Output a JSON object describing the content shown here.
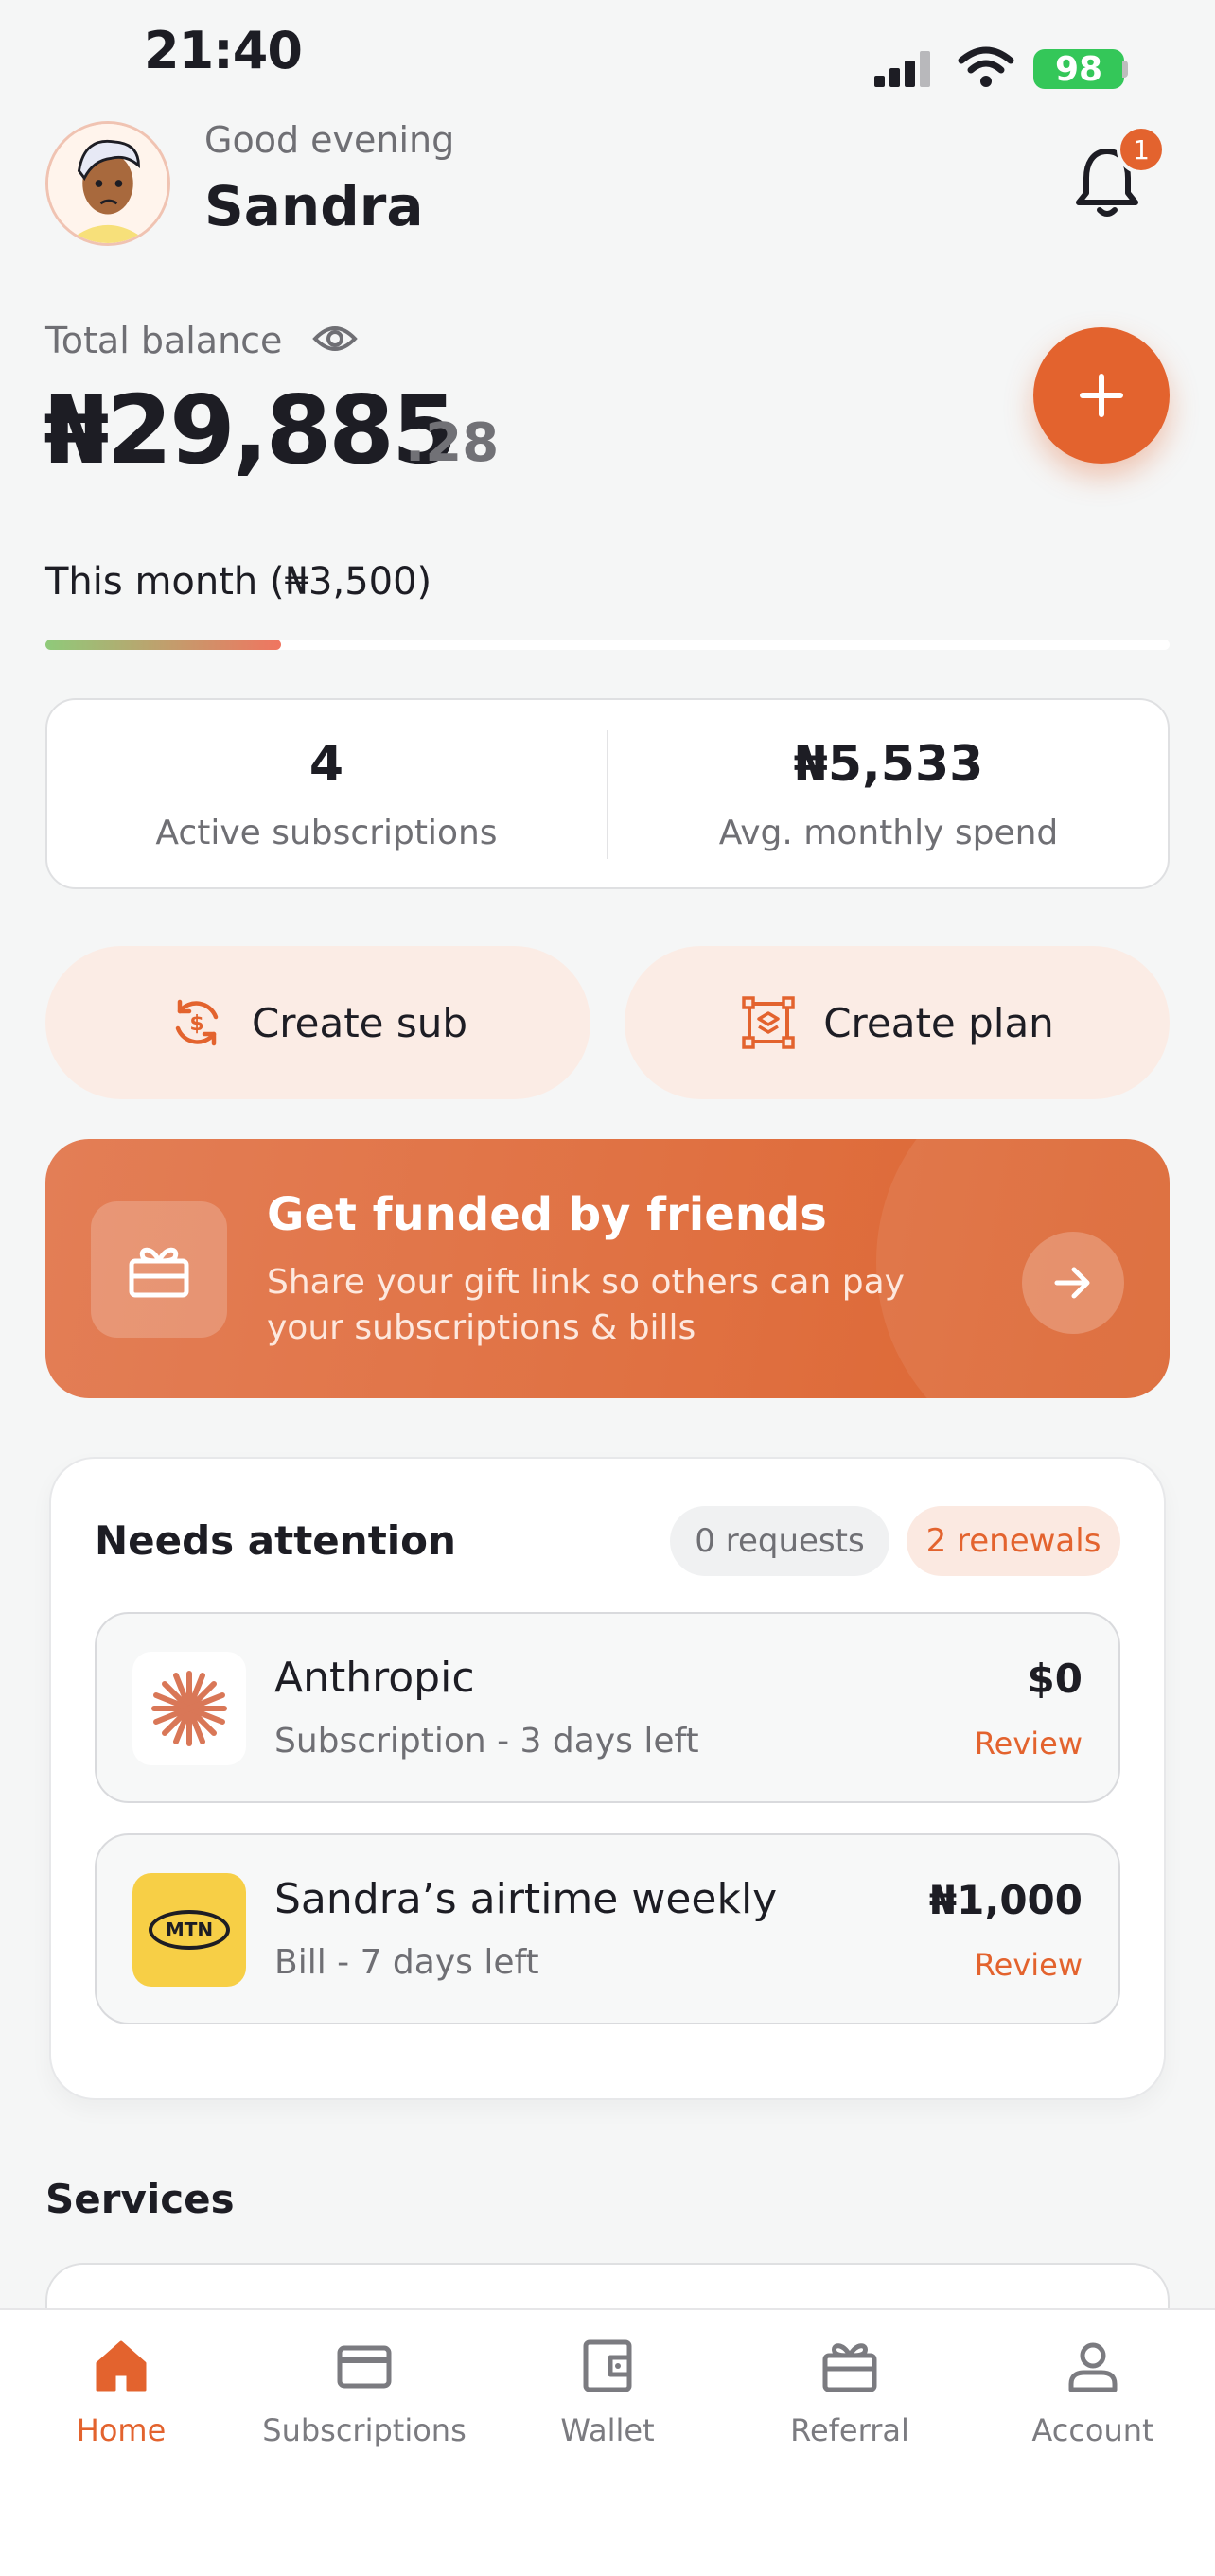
{
  "status_bar": {
    "time": "21:40",
    "battery": "98"
  },
  "header": {
    "greeting": "Good evening",
    "name": "Sandra",
    "notification_count": "1"
  },
  "balance": {
    "label": "Total balance",
    "main": "₦29,885",
    "cents": ".28"
  },
  "month": {
    "label": "This month (₦3,500)",
    "progress": 0.21
  },
  "stats": {
    "active_count": "4",
    "active_label": "Active subscriptions",
    "avg_amount": "₦5,533",
    "avg_label": "Avg. monthly spend"
  },
  "actions": {
    "create_sub": "Create sub",
    "create_plan": "Create plan"
  },
  "banner": {
    "title": "Get funded by friends",
    "subtitle": "Share your gift link so others can pay your subscriptions & bills"
  },
  "attention": {
    "title": "Needs attention",
    "requests_chip": "0 requests",
    "renewals_chip": "2 renewals",
    "items": [
      {
        "name": "Anthropic",
        "detail": "Subscription - 3 days left",
        "amount": "$0",
        "action": "Review",
        "logo": "anthropic-logo"
      },
      {
        "name": "Sandra’s airtime weekly",
        "detail": "Bill - 7 days left",
        "amount": "₦1,000",
        "action": "Review",
        "logo": "mtn-logo",
        "logo_text": "MTN"
      }
    ]
  },
  "services": {
    "title": "Services"
  },
  "tabs": [
    {
      "label": "Home",
      "icon": "home-icon",
      "active": true
    },
    {
      "label": "Subscriptions",
      "icon": "card-icon"
    },
    {
      "label": "Wallet",
      "icon": "wallet-icon"
    },
    {
      "label": "Referral",
      "icon": "gift-icon"
    },
    {
      "label": "Account",
      "icon": "user-icon"
    }
  ],
  "colors": {
    "accent": "#e3632e",
    "accent_soft": "#fbece5",
    "background": "#f5f6f6",
    "mtn_yellow": "#f7cf46"
  }
}
